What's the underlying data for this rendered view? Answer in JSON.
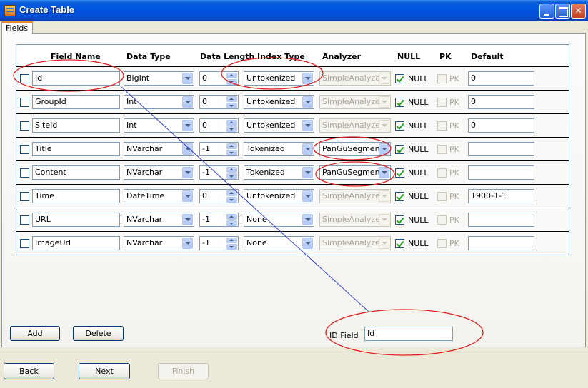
{
  "window": {
    "title": "Create Table"
  },
  "tabs": [
    {
      "label": "Fields"
    }
  ],
  "grid": {
    "headers": {
      "field_name": "Field Name",
      "data_type": "Data Type",
      "data_length": "Data Length",
      "index_type": "Index Type",
      "analyzer": "Analyzer",
      "null": "NULL",
      "pk": "PK",
      "default": "Default"
    },
    "rows": [
      {
        "name": "Id",
        "data_type": "BigInt",
        "length": "0",
        "index_type": "Untokenized",
        "analyzer": "SimpleAnalyzer",
        "analyzer_enabled": false,
        "null_label": "NULL",
        "null_checked": true,
        "pk_label": "PK",
        "default": "0"
      },
      {
        "name": "GroupId",
        "data_type": "Int",
        "length": "0",
        "index_type": "Untokenized",
        "analyzer": "SimpleAnalyzer",
        "analyzer_enabled": false,
        "null_label": "NULL",
        "null_checked": true,
        "pk_label": "PK",
        "default": "0"
      },
      {
        "name": "SiteId",
        "data_type": "Int",
        "length": "0",
        "index_type": "Untokenized",
        "analyzer": "SimpleAnalyzer",
        "analyzer_enabled": false,
        "null_label": "NULL",
        "null_checked": true,
        "pk_label": "PK",
        "default": "0"
      },
      {
        "name": "Title",
        "data_type": "NVarchar",
        "length": "-1",
        "index_type": "Tokenized",
        "analyzer": "PanGuSegment",
        "analyzer_enabled": true,
        "null_label": "NULL",
        "null_checked": true,
        "pk_label": "PK",
        "default": ""
      },
      {
        "name": "Content",
        "data_type": "NVarchar",
        "length": "-1",
        "index_type": "Tokenized",
        "analyzer": "PanGuSegment",
        "analyzer_enabled": true,
        "null_label": "NULL",
        "null_checked": true,
        "pk_label": "PK",
        "default": ""
      },
      {
        "name": "Time",
        "data_type": "DateTime",
        "length": "0",
        "index_type": "Untokenized",
        "analyzer": "SimpleAnalyzer",
        "analyzer_enabled": false,
        "null_label": "NULL",
        "null_checked": true,
        "pk_label": "PK",
        "default": "1900-1-1"
      },
      {
        "name": "URL",
        "data_type": "NVarchar",
        "length": "-1",
        "index_type": "None",
        "analyzer": "SimpleAnalyzer",
        "analyzer_enabled": false,
        "null_label": "NULL",
        "null_checked": true,
        "pk_label": "PK",
        "default": ""
      },
      {
        "name": "ImageUrl",
        "data_type": "NVarchar",
        "length": "-1",
        "index_type": "None",
        "analyzer": "SimpleAnalyzer",
        "analyzer_enabled": false,
        "null_label": "NULL",
        "null_checked": true,
        "pk_label": "PK",
        "default": ""
      }
    ]
  },
  "actions": {
    "add_label": "Add",
    "delete_label": "Delete"
  },
  "id_field": {
    "label": "ID Field",
    "value": "Id"
  },
  "navigation": {
    "back_label": "Back",
    "next_label": "Next",
    "finish_label": "Finish"
  },
  "colors": {
    "titlebar": "#0054e3",
    "annotation_red": "#e02020",
    "annotation_line": "#2e3fd0",
    "window_bg": "#ece9d8"
  }
}
